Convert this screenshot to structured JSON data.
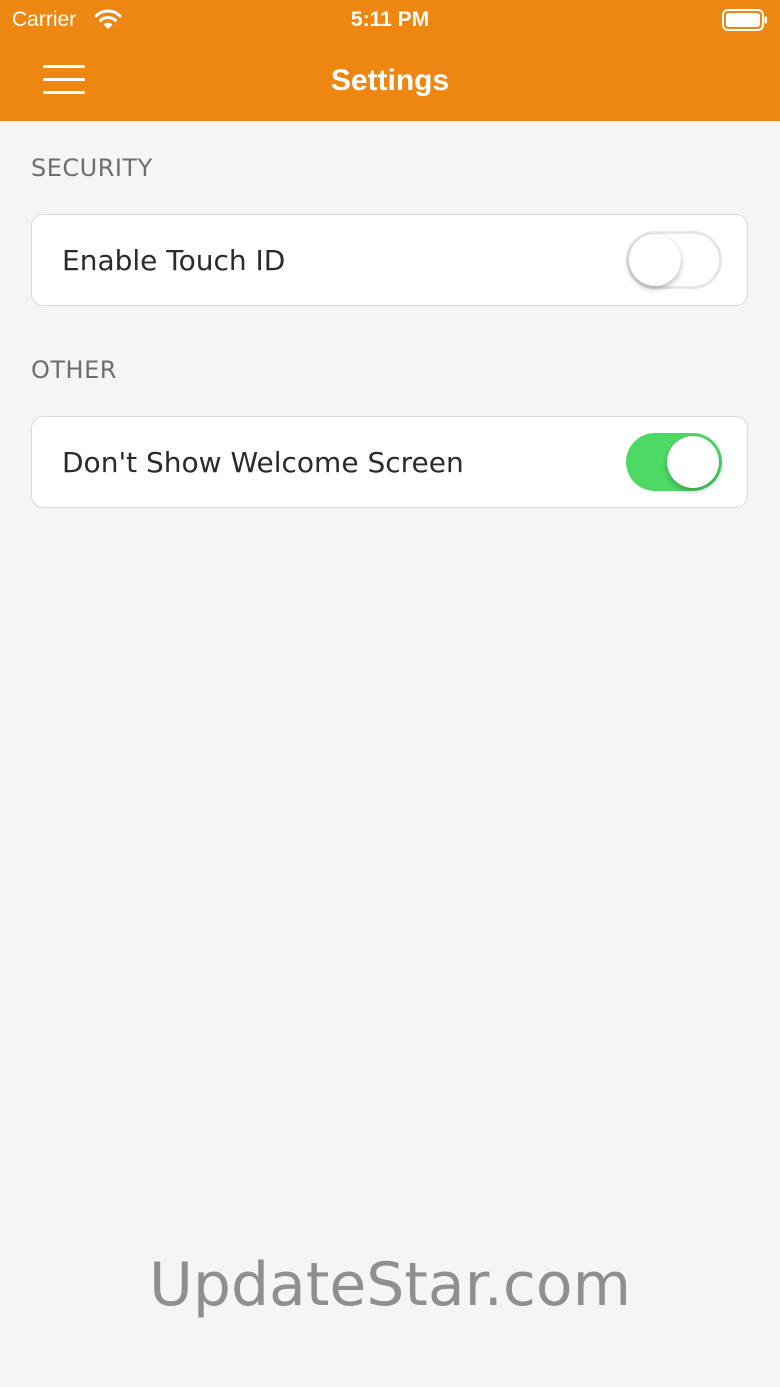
{
  "status_bar": {
    "carrier": "Carrier",
    "wifi_icon": "wifi-icon",
    "time": "5:11 PM",
    "battery_icon": "battery-icon"
  },
  "nav_bar": {
    "title": "Settings",
    "menu_icon": "hamburger-menu-icon",
    "background_color": "#ee8711"
  },
  "sections": [
    {
      "header": "SECURITY",
      "rows": [
        {
          "label": "Enable Touch ID",
          "toggle_on": false
        }
      ]
    },
    {
      "header": "OTHER",
      "rows": [
        {
          "label": "Don't Show Welcome Screen",
          "toggle_on": true
        }
      ]
    }
  ],
  "watermark": "UpdateStar.com",
  "colors": {
    "accent": "#ee8711",
    "toggle_on": "#4cd964",
    "background": "#f5f5f5"
  }
}
